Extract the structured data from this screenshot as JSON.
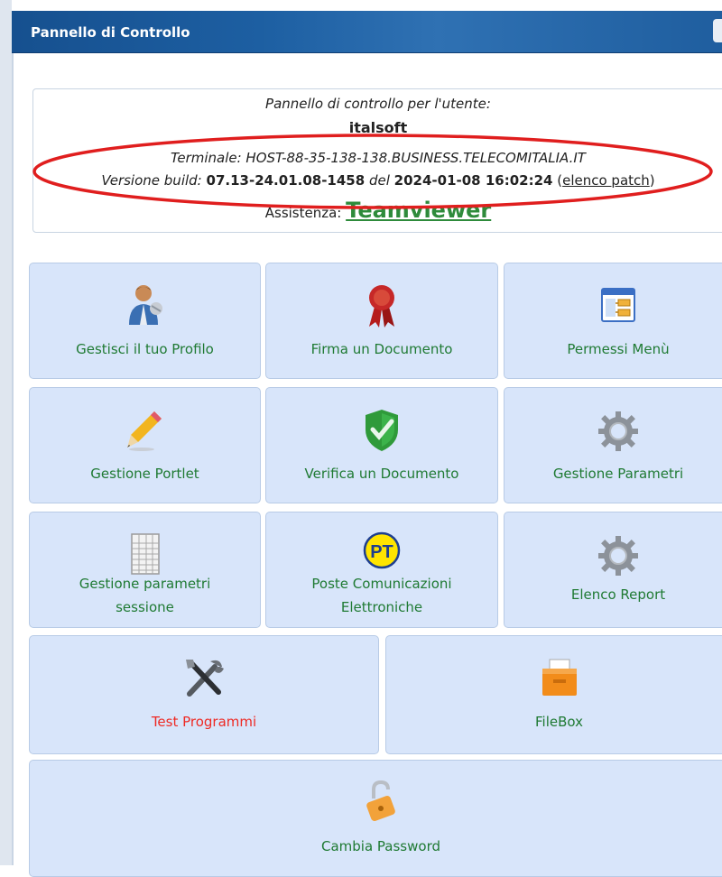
{
  "header": {
    "title": "Pannello di Controllo"
  },
  "info": {
    "line1": "Pannello di controllo per l'utente:",
    "username": "italsoft",
    "terminal": "Terminale: HOST-88-35-138-138.BUSINESS.TELECOMITALIA.IT",
    "build_prefix": "Versione build:",
    "build_version": "07.13-24.01.08-1458",
    "build_del": "del",
    "build_datetime": "2024-01-08 16:02:24",
    "patch_open": "(",
    "patch_link": "elenco patch",
    "patch_close": ")",
    "assist_label": "Assistenza:",
    "assist_link": "Teamviewer"
  },
  "tiles": [
    {
      "label": "Gestisci il tuo Profilo",
      "icon": "user-profile-icon"
    },
    {
      "label": "Firma un Documento",
      "icon": "ribbon-seal-icon"
    },
    {
      "label": "Permessi Menù",
      "icon": "menu-window-icon"
    },
    {
      "label": "Gestione Portlet",
      "icon": "pencil-icon"
    },
    {
      "label": "Verifica un Documento",
      "icon": "shield-check-icon"
    },
    {
      "label": "Gestione Parametri",
      "icon": "gear-icon"
    },
    {
      "label": "Gestione parametri",
      "label2": "sessione",
      "icon": "spreadsheet-icon"
    },
    {
      "label": "Poste Comunicazioni",
      "label2": "Elettroniche",
      "icon": "pt-badge-icon",
      "badge_text": "PT"
    },
    {
      "label": "Elenco Report",
      "icon": "gear-icon"
    },
    {
      "label": "Test Programmi",
      "icon": "tools-icon"
    },
    {
      "label": "FileBox",
      "icon": "file-box-icon"
    },
    {
      "label": "Cambia Password",
      "icon": "padlock-open-icon"
    }
  ],
  "colors": {
    "header_blue": "#1d5fa2",
    "tile_bg": "#d8e5fa",
    "label_green": "#1f7a33",
    "label_red": "#ee2a24",
    "annotation_red": "#e01e1e",
    "teamviewer_green": "#2e8b3b"
  }
}
